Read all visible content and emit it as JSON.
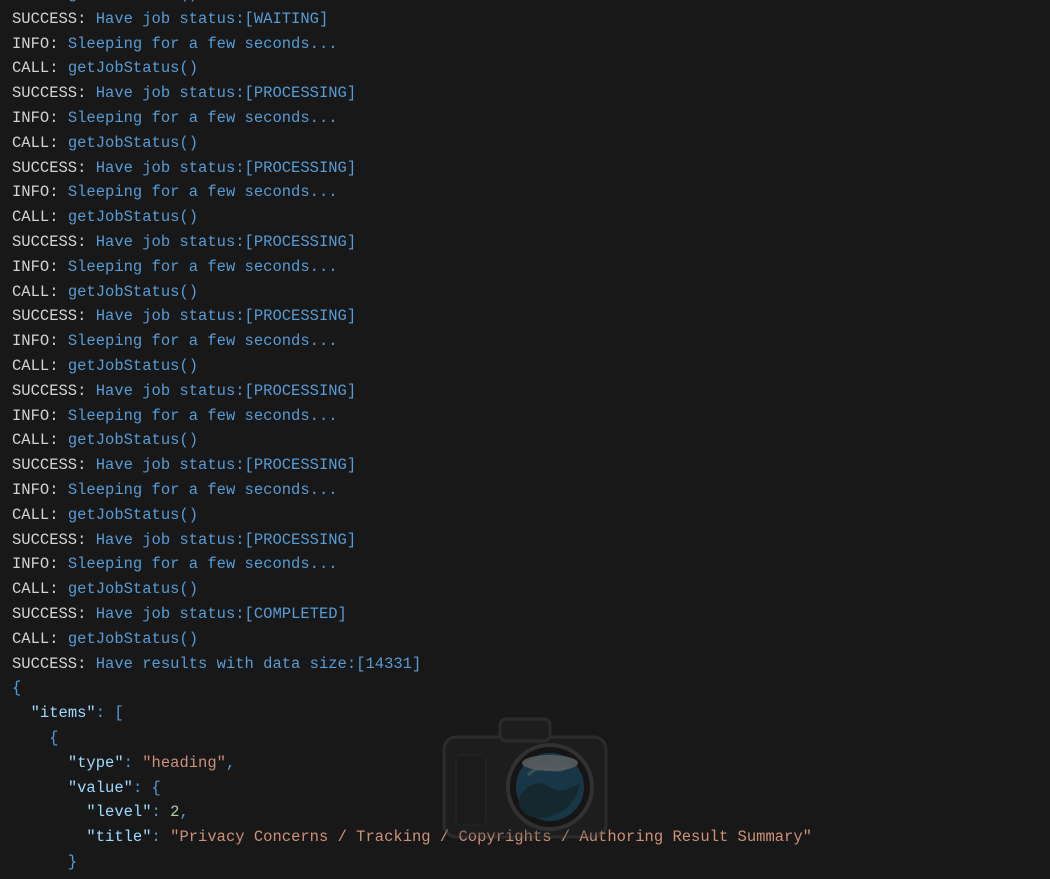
{
  "log": [
    {
      "kind": "call",
      "label": "CALL:",
      "fn": "getJobStatus()"
    },
    {
      "kind": "succ",
      "label": "SUCCESS:",
      "msg": "Have job status:",
      "tag": "[WAITING]"
    },
    {
      "kind": "info",
      "label": "INFO:",
      "msg": "Sleeping for a few seconds..."
    },
    {
      "kind": "call",
      "label": "CALL:",
      "fn": "getJobStatus()"
    },
    {
      "kind": "succ",
      "label": "SUCCESS:",
      "msg": "Have job status:",
      "tag": "[PROCESSING]"
    },
    {
      "kind": "info",
      "label": "INFO:",
      "msg": "Sleeping for a few seconds..."
    },
    {
      "kind": "call",
      "label": "CALL:",
      "fn": "getJobStatus()"
    },
    {
      "kind": "succ",
      "label": "SUCCESS:",
      "msg": "Have job status:",
      "tag": "[PROCESSING]"
    },
    {
      "kind": "info",
      "label": "INFO:",
      "msg": "Sleeping for a few seconds..."
    },
    {
      "kind": "call",
      "label": "CALL:",
      "fn": "getJobStatus()"
    },
    {
      "kind": "succ",
      "label": "SUCCESS:",
      "msg": "Have job status:",
      "tag": "[PROCESSING]"
    },
    {
      "kind": "info",
      "label": "INFO:",
      "msg": "Sleeping for a few seconds..."
    },
    {
      "kind": "call",
      "label": "CALL:",
      "fn": "getJobStatus()"
    },
    {
      "kind": "succ",
      "label": "SUCCESS:",
      "msg": "Have job status:",
      "tag": "[PROCESSING]"
    },
    {
      "kind": "info",
      "label": "INFO:",
      "msg": "Sleeping for a few seconds..."
    },
    {
      "kind": "call",
      "label": "CALL:",
      "fn": "getJobStatus()"
    },
    {
      "kind": "succ",
      "label": "SUCCESS:",
      "msg": "Have job status:",
      "tag": "[PROCESSING]"
    },
    {
      "kind": "info",
      "label": "INFO:",
      "msg": "Sleeping for a few seconds..."
    },
    {
      "kind": "call",
      "label": "CALL:",
      "fn": "getJobStatus()"
    },
    {
      "kind": "succ",
      "label": "SUCCESS:",
      "msg": "Have job status:",
      "tag": "[PROCESSING]"
    },
    {
      "kind": "info",
      "label": "INFO:",
      "msg": "Sleeping for a few seconds..."
    },
    {
      "kind": "call",
      "label": "CALL:",
      "fn": "getJobStatus()"
    },
    {
      "kind": "succ",
      "label": "SUCCESS:",
      "msg": "Have job status:",
      "tag": "[PROCESSING]"
    },
    {
      "kind": "info",
      "label": "INFO:",
      "msg": "Sleeping for a few seconds..."
    },
    {
      "kind": "call",
      "label": "CALL:",
      "fn": "getJobStatus()"
    },
    {
      "kind": "succ",
      "label": "SUCCESS:",
      "msg": "Have job status:",
      "tag": "[COMPLETED]"
    },
    {
      "kind": "call",
      "label": "CALL:",
      "fn": "getJobStatus()"
    },
    {
      "kind": "succ",
      "label": "SUCCESS:",
      "msg": "Have results with data size:",
      "tag": "[14331]"
    }
  ],
  "json_lines": [
    {
      "indent": 0,
      "text": "{"
    },
    {
      "indent": 1,
      "key": "items",
      "after": ": ["
    },
    {
      "indent": 2,
      "text": "{"
    },
    {
      "indent": 3,
      "key": "type",
      "str": "heading",
      "comma": true
    },
    {
      "indent": 3,
      "key": "value",
      "after": ": {"
    },
    {
      "indent": 4,
      "key": "level",
      "num": "2",
      "comma": true
    },
    {
      "indent": 4,
      "key": "title",
      "str": "Privacy Concerns / Tracking / Copyrights / Authoring Result Summary"
    },
    {
      "indent": 3,
      "text": "}"
    }
  ]
}
